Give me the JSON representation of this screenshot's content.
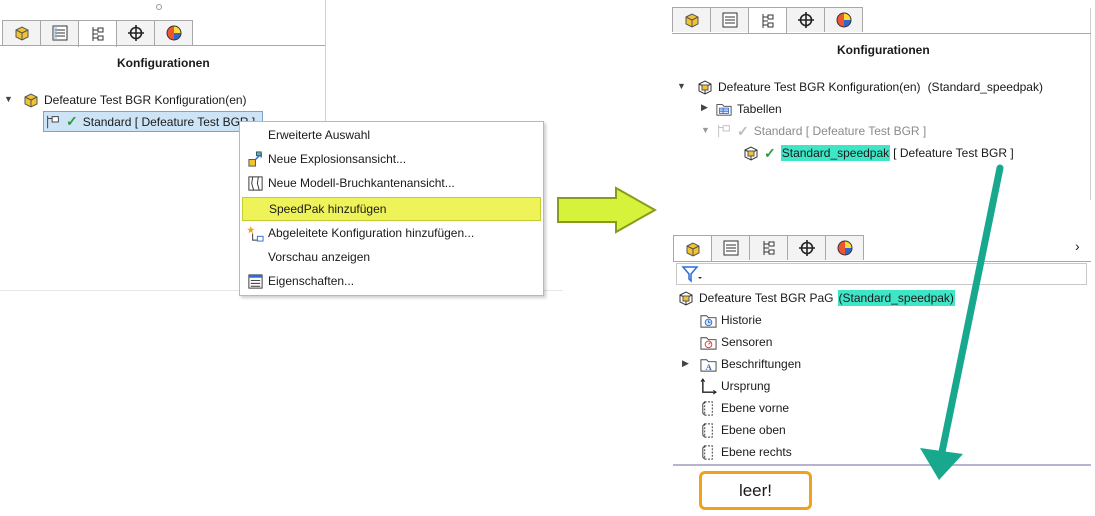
{
  "left_panel": {
    "title": "Konfigurationen",
    "tree_root": "Defeature Test BGR Konfiguration(en)",
    "selected_item": "Standard [ Defeature Test BGR ]"
  },
  "context_menu": {
    "items": [
      {
        "label": "Erweiterte Auswahl",
        "icon": "none"
      },
      {
        "label": "Neue Explosionsansicht...",
        "icon": "explode-icon"
      },
      {
        "label": "Neue Modell-Bruchkantenansicht...",
        "icon": "break-view-icon"
      },
      {
        "label": "SpeedPak hinzufügen",
        "icon": "none"
      },
      {
        "label": "Abgeleitete Konfiguration hinzufügen...",
        "icon": "derived-config-icon"
      },
      {
        "label": "Vorschau anzeigen",
        "icon": "none"
      },
      {
        "label": "Eigenschaften...",
        "icon": "properties-icon"
      }
    ]
  },
  "right_top_panel": {
    "title": "Konfigurationen",
    "tree_root": "Defeature Test BGR Konfiguration(en)",
    "tree_root_suffix": "(Standard_speedpak)",
    "tables": "Tabellen",
    "standard": "Standard [ Defeature Test BGR ]",
    "speedpak_name": "Standard_speedpak",
    "speedpak_suffix": "[ Defeature Test BGR ]"
  },
  "right_bottom_panel": {
    "root_name": "Defeature Test BGR PaG",
    "root_config": "(Standard_speedpak)",
    "items": [
      "Historie",
      "Sensoren",
      "Beschriftungen",
      "Ursprung",
      "Ebene vorne",
      "Ebene oben",
      "Ebene rechts"
    ]
  },
  "annotation": {
    "empty_label": "leer!"
  },
  "colors": {
    "highlight_teal": "#3ee6c7",
    "menu_selected": "#eef35a",
    "arrow_yellow": "#d7f23a",
    "arrow_green": "#17a88e",
    "box_orange": "#f0a21c"
  }
}
